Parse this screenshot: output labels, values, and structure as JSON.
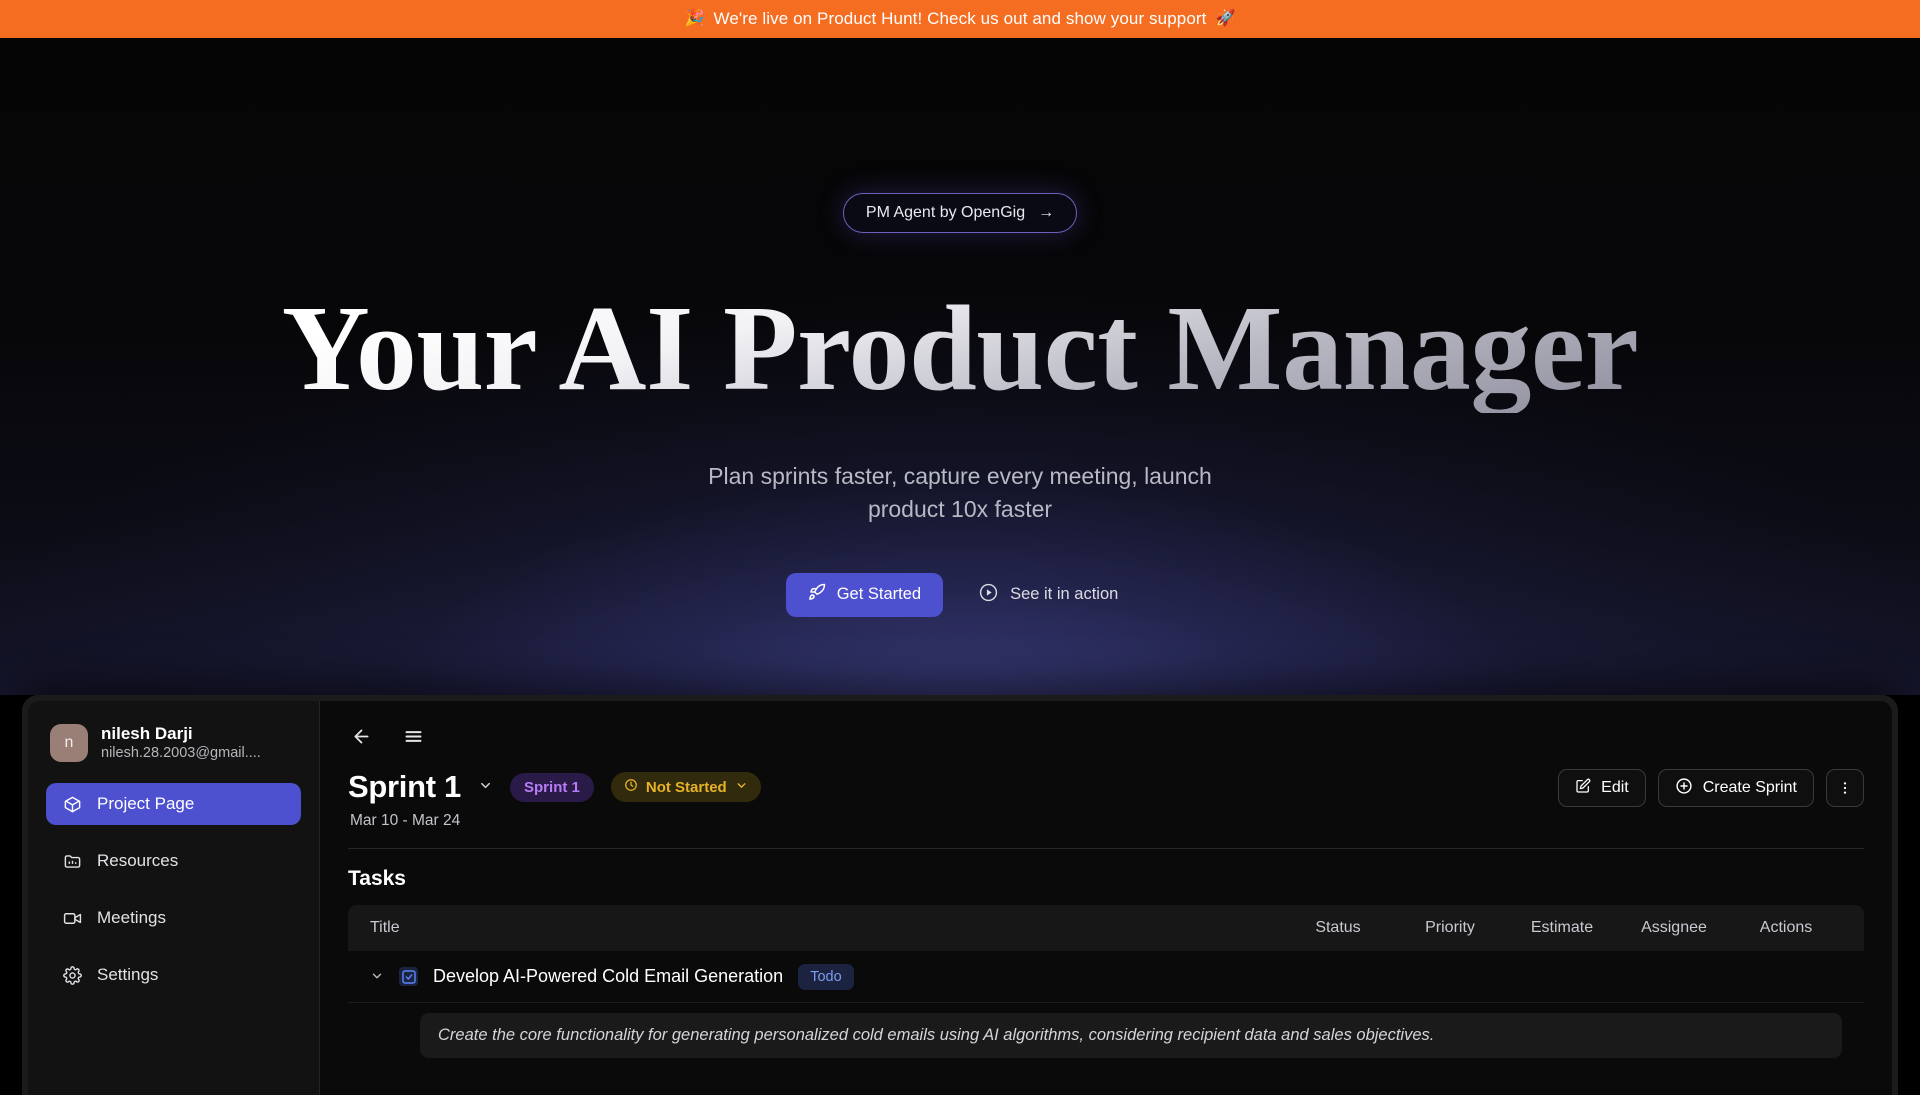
{
  "promo": {
    "left_emoji": "🎉",
    "text": "We're live on Product Hunt! Check us out and show your support",
    "right_emoji": "🚀",
    "bg_color": "#F56D20"
  },
  "hero": {
    "pill_label": "PM Agent by OpenGig",
    "pill_arrow": "→",
    "title": "Your AI Product Manager",
    "subtitle": "Plan sprints faster, capture every meeting, launch product 10x faster",
    "cta_primary": "Get Started",
    "cta_secondary": "See it in action",
    "accent_color": "#4d50cf"
  },
  "sidebar": {
    "user": {
      "initial": "n",
      "name": "nilesh Darji",
      "email": "nilesh.28.2003@gmail...."
    },
    "items": [
      {
        "label": "Project Page",
        "icon": "cube-icon",
        "active": true
      },
      {
        "label": "Resources",
        "icon": "folder-icon",
        "active": false
      },
      {
        "label": "Meetings",
        "icon": "video-icon",
        "active": false
      },
      {
        "label": "Settings",
        "icon": "gear-icon",
        "active": false
      }
    ]
  },
  "main": {
    "sprint": {
      "title": "Sprint 1",
      "tag": "Sprint 1",
      "status": "Not Started",
      "dates": "Mar 10 - Mar 24"
    },
    "actions": {
      "edit": "Edit",
      "create_sprint": "Create Sprint",
      "more": "⋮"
    },
    "tasks_heading": "Tasks",
    "columns": {
      "title": "Title",
      "status": "Status",
      "priority": "Priority",
      "estimate": "Estimate",
      "assignee": "Assignee",
      "actions": "Actions"
    },
    "rows": [
      {
        "name": "Develop AI-Powered Cold Email Generation",
        "badge": "Todo",
        "description": "Create the core functionality for generating personalized cold emails using AI algorithms, considering recipient data and sales objectives."
      }
    ]
  }
}
